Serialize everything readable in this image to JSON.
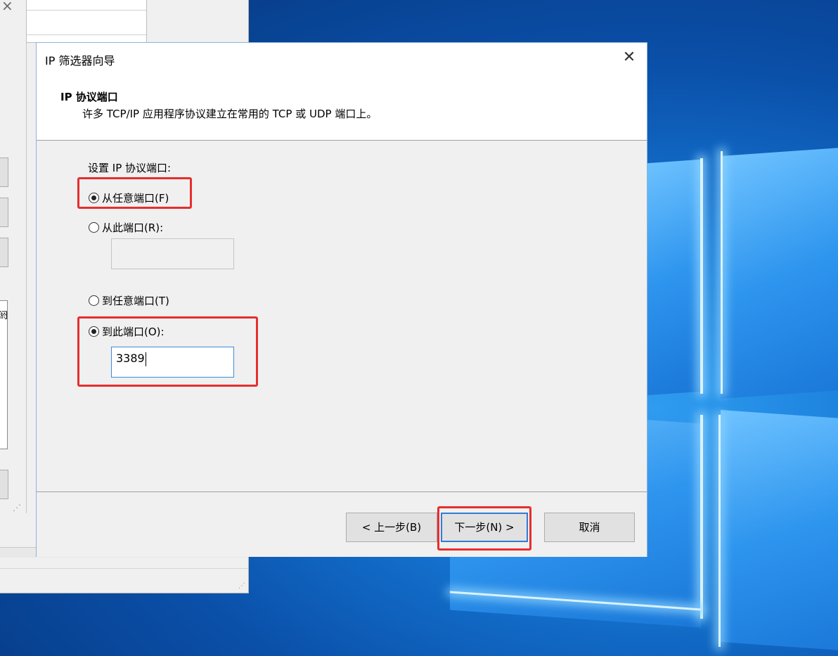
{
  "desktop": {
    "logo_name": "windows-logo"
  },
  "dialog": {
    "title": "IP 筛选器向导",
    "close_glyph": "✕",
    "header": {
      "title": "IP 协议端口",
      "subtitle": "许多 TCP/IP 应用程序协议建立在常用的 TCP 或 UDP 端口上。"
    },
    "body": {
      "group_label": "设置 IP 协议端口:",
      "from_any": {
        "label": "从任意端口(F)",
        "selected": true
      },
      "from_this": {
        "label": "从此端口(R):",
        "selected": false,
        "value": ""
      },
      "to_any": {
        "label": "到任意端口(T)",
        "selected": false
      },
      "to_this": {
        "label": "到此端口(O):",
        "selected": true,
        "value": "3389"
      }
    },
    "buttons": {
      "back": "< 上一步(B)",
      "next": "下一步(N) >",
      "cancel": "取消"
    }
  },
  "background_window": {
    "list_fragment": "阏"
  },
  "colors": {
    "highlight_border": "#e62e2e",
    "focus_blue": "#2f7dd4"
  }
}
